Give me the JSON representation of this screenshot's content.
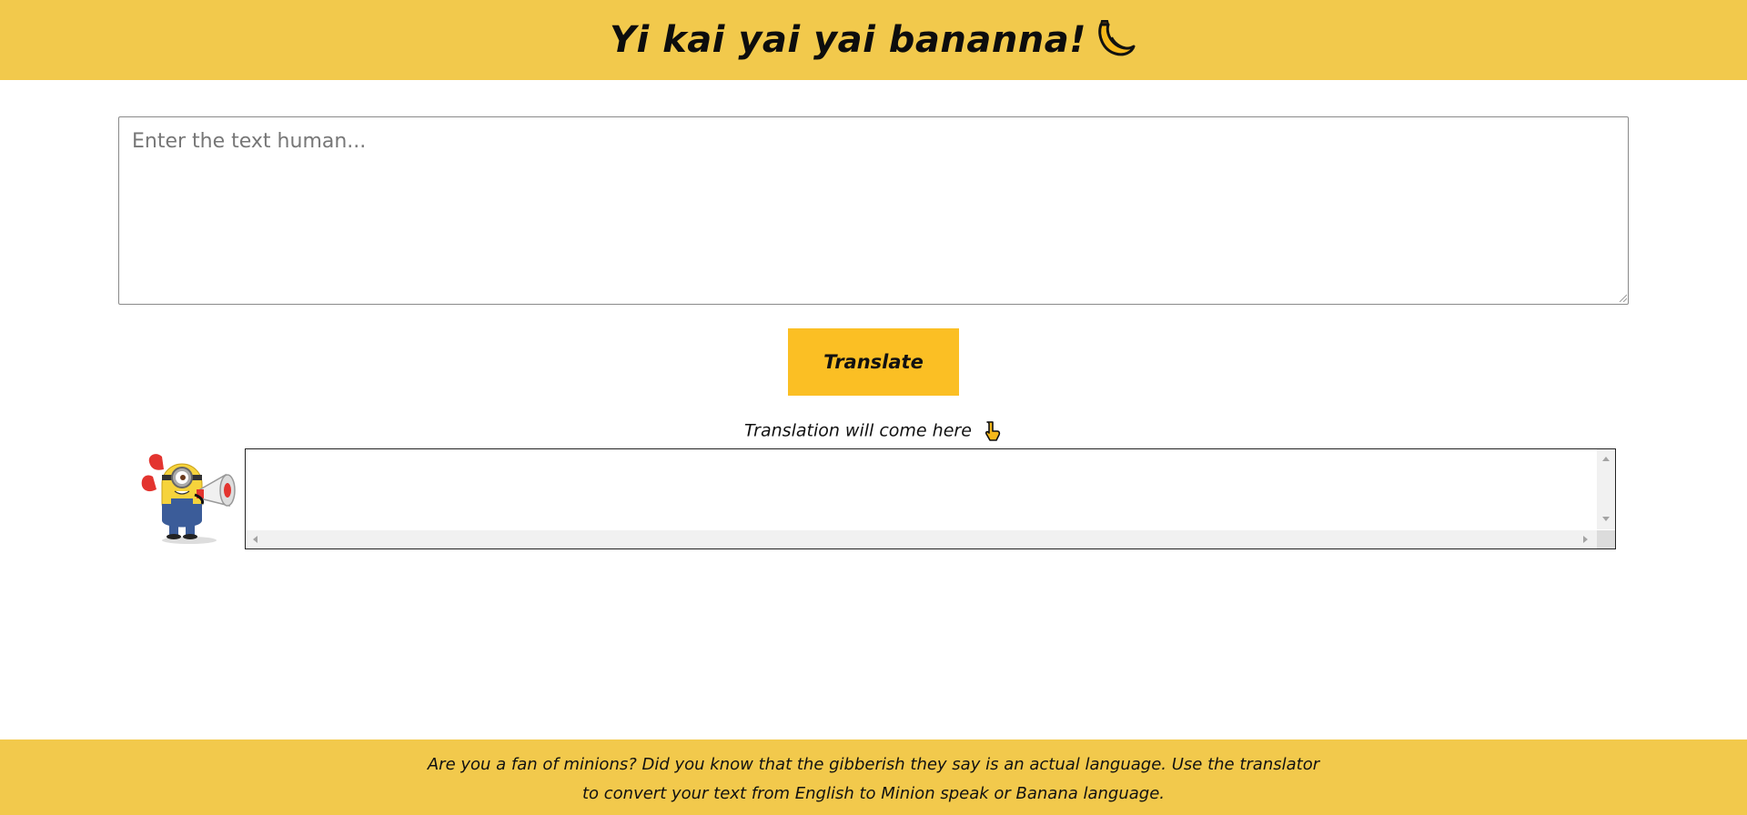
{
  "header": {
    "title": "Yi kai yai yai bananna!",
    "icon": "banana-icon",
    "background": "#f2c94c"
  },
  "input": {
    "placeholder": "Enter the text human...",
    "value": ""
  },
  "translate_button": {
    "label": "Translate",
    "color": "#fbbf24"
  },
  "output": {
    "label": "Translation will come here",
    "label_icon": "pointing-down-icon",
    "avatar": "minion-megaphone-image",
    "value": ""
  },
  "footer": {
    "text_line1": "Are you a fan of minions? Did you know that the gibberish they say is an actual language. Use the translator",
    "text_line2": "to convert your text from English to Minion speak or Banana language."
  }
}
